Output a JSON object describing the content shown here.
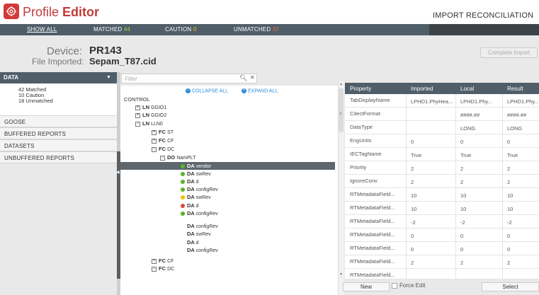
{
  "header": {
    "app_name_light": "Profile",
    "app_name_bold": "Editor",
    "right_title": "IMPORT RECONCILIATION"
  },
  "tabs": {
    "show_all": "SHOW ALL",
    "matched_label": "MATCHED",
    "matched_count": "44",
    "caution_label": "CAUTION",
    "caution_count": "0",
    "unmatched_label": "UNMATCHED",
    "unmatched_count": "37"
  },
  "device": {
    "device_label": "Device:",
    "device_value": "PR143",
    "file_label": "File Imported:",
    "file_value": "Sepam_T87.cid",
    "complete_button": "Complete Import"
  },
  "sidebar": {
    "data_header": "DATA",
    "counts": [
      "42  Matched",
      "10  Caution",
      "18  Unmatched"
    ],
    "items": [
      "GOOSE",
      "BUFFERED REPORTS",
      "DATASETS",
      "UNBUFFERED REPORTS"
    ]
  },
  "filter": {
    "placeholder": "Filter"
  },
  "tree": {
    "collapse_all": "COLLAPSE ALL",
    "expand_all": "EXPAND ALL",
    "root": "CONTROL",
    "rows": [
      {
        "kind": "LN",
        "name": "GGIO1",
        "expander": "+"
      },
      {
        "kind": "LN",
        "name": "GGIO2",
        "expander": "+"
      },
      {
        "kind": "LN",
        "name": "LLN0",
        "expander": "-"
      },
      {
        "kind": "FC",
        "name": "ST",
        "expander": "+"
      },
      {
        "kind": "FC",
        "name": "CF",
        "expander": "+"
      },
      {
        "kind": "FC",
        "name": "DC",
        "expander": "-"
      },
      {
        "kind": "DO",
        "name": "NamPLT",
        "expander": "-"
      },
      {
        "kind": "DA",
        "name": "vendor",
        "status": "green"
      },
      {
        "kind": "DA",
        "name": "swRev",
        "status": "green"
      },
      {
        "kind": "DA",
        "name": "d",
        "status": "green"
      },
      {
        "kind": "DA",
        "name": "configRev",
        "status": "green"
      },
      {
        "kind": "DA",
        "name": "swRev",
        "status": "yellow"
      },
      {
        "kind": "DA",
        "name": "d",
        "status": "red"
      },
      {
        "kind": "DA",
        "name": "configRev",
        "status": "green"
      },
      {
        "kind": "DA",
        "name": "configRev",
        "status": "none"
      },
      {
        "kind": "DA",
        "name": "swRev",
        "status": "none"
      },
      {
        "kind": "DA",
        "name": "d",
        "status": "none"
      },
      {
        "kind": "DA",
        "name": "configRev",
        "status": "none"
      },
      {
        "kind": "FC",
        "name": "CF",
        "expander": "+"
      },
      {
        "kind": "FC",
        "name": "DC",
        "expander": "-"
      }
    ]
  },
  "properties": {
    "headers": [
      "Property",
      "Imported",
      "Local",
      "Result"
    ],
    "rows": [
      [
        "TabDisplayName",
        "LPHD1.PhyHea...",
        "LPHD1.Phy...",
        "LPHD1.Phy..."
      ],
      [
        "CitectFormat",
        "",
        "####.##",
        "####.##"
      ],
      [
        "DataType",
        "",
        "LONG",
        "LONG"
      ],
      [
        "EngUnits",
        "0",
        "0",
        "0"
      ],
      [
        "IECTagName",
        "True",
        "True",
        "True"
      ],
      [
        "Priority",
        "2",
        "2",
        "2"
      ],
      [
        "IgnoreConv",
        "2",
        "2",
        "2"
      ],
      [
        "RTMetadataField...",
        "10",
        "10",
        "10"
      ],
      [
        "RTMetadataField...",
        "10",
        "10",
        "10"
      ],
      [
        "RTMetadataField...",
        "-2",
        "-2",
        "-2"
      ],
      [
        "RTMetadataField...",
        "0",
        "0",
        "0"
      ],
      [
        "RTMetadataField...",
        "0",
        "0",
        "0"
      ],
      [
        "RTMetadataField...",
        "2",
        "2",
        "2"
      ],
      [
        "RTMetadataField...",
        "",
        "",
        ""
      ]
    ]
  },
  "footer": {
    "new_button": "New",
    "force_edit": "Force Edit",
    "select_button": "Select"
  },
  "colors": {
    "header_bar": "#4f5e68",
    "brand_red": "#c23b3b",
    "status_green": "#59b32a",
    "status_yellow": "#f2c400",
    "status_red": "#e0453a",
    "link_blue": "#2a8bd8"
  }
}
